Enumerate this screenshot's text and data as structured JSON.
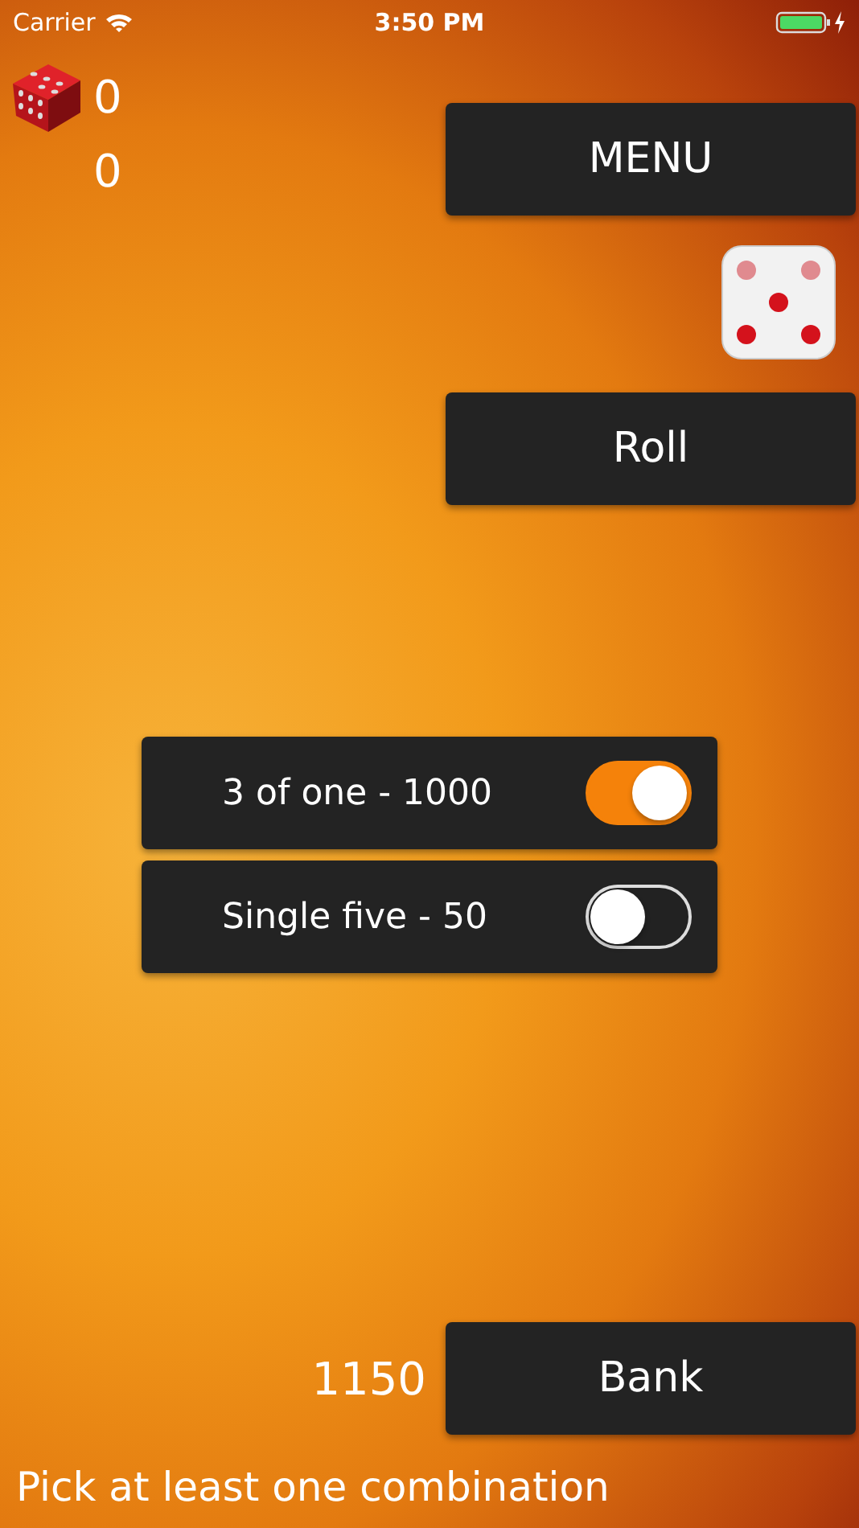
{
  "status_bar": {
    "carrier": "Carrier",
    "time": "3:50 PM"
  },
  "scores": [
    "0",
    "0"
  ],
  "buttons": {
    "menu": "MENU",
    "roll": "Roll",
    "bank": "Bank"
  },
  "combinations": [
    {
      "label": "3 of one - 1000",
      "on": true
    },
    {
      "label": "Single five - 50",
      "on": false
    }
  ],
  "bank_total": "1150",
  "message": "Pick at least one combination"
}
